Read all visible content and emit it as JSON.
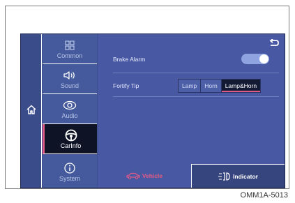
{
  "sidebar": {
    "items": [
      {
        "label": "Common",
        "icon": "grid-icon"
      },
      {
        "label": "Sound",
        "icon": "speaker-icon"
      },
      {
        "label": "Audio",
        "icon": "audio-icon"
      },
      {
        "label": "CarInfo",
        "icon": "steering-wheel-icon",
        "active": true
      },
      {
        "label": "System",
        "icon": "info-icon"
      }
    ]
  },
  "settings": {
    "brake_alarm_label": "Brake Alarm",
    "brake_alarm_on": true,
    "fortify_tip_label": "Fortify Tip",
    "fortify_options": [
      "Lamp",
      "Horn",
      "Lamp&Horn"
    ],
    "fortify_selected": "Lamp&Horn"
  },
  "tabs": {
    "vehicle": "Vehicle",
    "indicator": "Indicator"
  },
  "caption": "OMM1A-5013",
  "colors": {
    "accent": "#e05a86",
    "screen_bg": "#4858a2",
    "toggle_on": "#8ea3e0"
  }
}
